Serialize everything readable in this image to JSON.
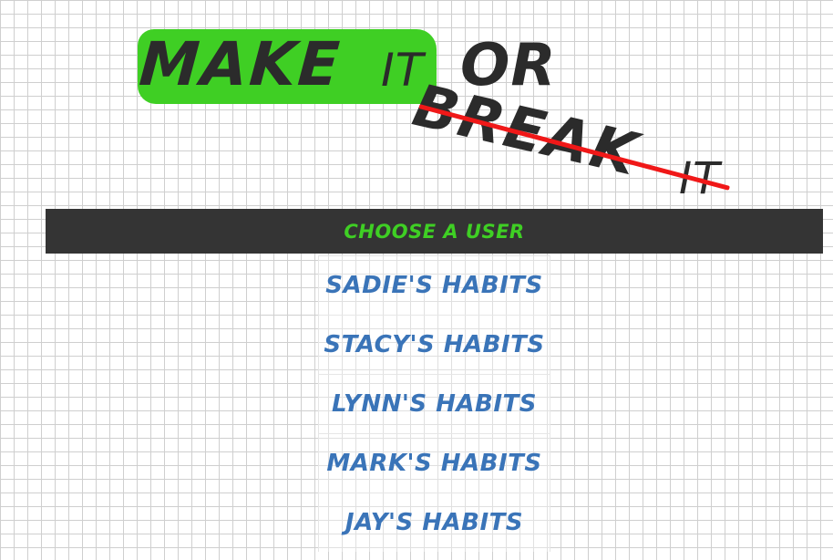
{
  "logo": {
    "word_make": "Make",
    "word_it_1": "it",
    "word_or": "or",
    "word_break": "Break",
    "word_it_2": "it"
  },
  "choose_bar": {
    "label": "Choose a user"
  },
  "users": [
    {
      "label": "Sadie's Habits"
    },
    {
      "label": "Stacy's Habits"
    },
    {
      "label": "Lynn's Habits"
    },
    {
      "label": "Mark's Habits"
    },
    {
      "label": "Jay's Habits"
    }
  ],
  "colors": {
    "highlight_green": "#3fcf24",
    "strike_red": "#f01818",
    "bar_dark": "#343434",
    "link_blue": "#3a74b8",
    "logo_text": "#2b2b2b"
  }
}
